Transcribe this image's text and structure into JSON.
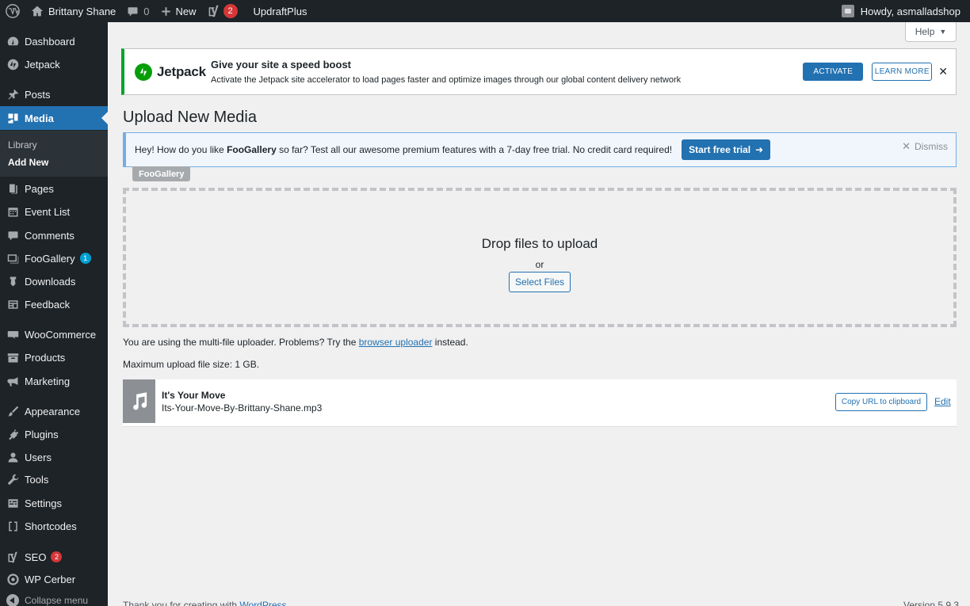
{
  "admin_bar": {
    "site_name": "Brittany Shane",
    "comments_count": "0",
    "new_label": "New",
    "yoast_count": "2",
    "updraft_label": "UpdraftPlus",
    "howdy": "Howdy, asmalladshop"
  },
  "sidebar": {
    "items": [
      {
        "label": "Dashboard",
        "icon": "dashboard-icon"
      },
      {
        "label": "Jetpack",
        "icon": "jetpack-icon"
      },
      {
        "label": "Posts",
        "icon": "pin-icon"
      },
      {
        "label": "Media",
        "icon": "media-icon"
      },
      {
        "label": "Pages",
        "icon": "page-icon"
      },
      {
        "label": "Event List",
        "icon": "calendar-icon"
      },
      {
        "label": "Comments",
        "icon": "comment-icon"
      },
      {
        "label": "FooGallery",
        "icon": "gallery-icon",
        "badge": "1"
      },
      {
        "label": "Downloads",
        "icon": "download-icon"
      },
      {
        "label": "Feedback",
        "icon": "feedback-icon"
      },
      {
        "label": "WooCommerce",
        "icon": "woo-icon"
      },
      {
        "label": "Products",
        "icon": "archive-icon"
      },
      {
        "label": "Marketing",
        "icon": "megaphone-icon"
      },
      {
        "label": "Appearance",
        "icon": "brush-icon"
      },
      {
        "label": "Plugins",
        "icon": "plug-icon"
      },
      {
        "label": "Users",
        "icon": "user-icon"
      },
      {
        "label": "Tools",
        "icon": "wrench-icon"
      },
      {
        "label": "Settings",
        "icon": "settings-icon"
      },
      {
        "label": "Shortcodes",
        "icon": "brackets-icon"
      },
      {
        "label": "SEO",
        "icon": "yoast-icon",
        "badge": "2"
      },
      {
        "label": "WP Cerber",
        "icon": "cerber-icon"
      }
    ],
    "submenu": {
      "library": "Library",
      "add_new": "Add New"
    },
    "collapse": "Collapse menu"
  },
  "help": {
    "label": "Help"
  },
  "jetpack_notice": {
    "logo_text": "Jetpack",
    "title": "Give your site a speed boost",
    "description": "Activate the Jetpack site accelerator to load pages faster and optimize images through our global content delivery network",
    "activate": "ACTIVATE",
    "learn_more": "LEARN MORE",
    "close": "✕"
  },
  "page": {
    "title": "Upload New Media"
  },
  "foo_notice": {
    "text_before": "Hey! How do you like ",
    "brand": "FooGallery",
    "text_after": " so far? Test all our awesome premium features with a 7-day free trial. No credit card required!",
    "button": "Start free trial",
    "button_arrow": "➜",
    "dismiss": "Dismiss",
    "tag": "FooGallery"
  },
  "dropzone": {
    "title": "Drop files to upload",
    "or": "or",
    "select": "Select Files"
  },
  "uploader_info": {
    "text_before": "You are using the multi-file uploader. Problems? Try the ",
    "link": "browser uploader",
    "text_after": " instead.",
    "max_size": "Maximum upload file size: 1 GB."
  },
  "media_item": {
    "title": "It's Your Move",
    "filename": "Its-Your-Move-By-Brittany-Shane.mp3",
    "copy_button": "Copy URL to clipboard",
    "edit": "Edit"
  },
  "footer": {
    "thanks_before": "Thank you for creating with ",
    "thanks_link": "WordPress",
    "version": "Version 5.9.3"
  },
  "colors": {
    "accent": "#2271b1",
    "admin_bg": "#1d2327",
    "jetpack_green": "#069e08",
    "badge_red": "#d63638",
    "badge_blue": "#00a0d2"
  }
}
